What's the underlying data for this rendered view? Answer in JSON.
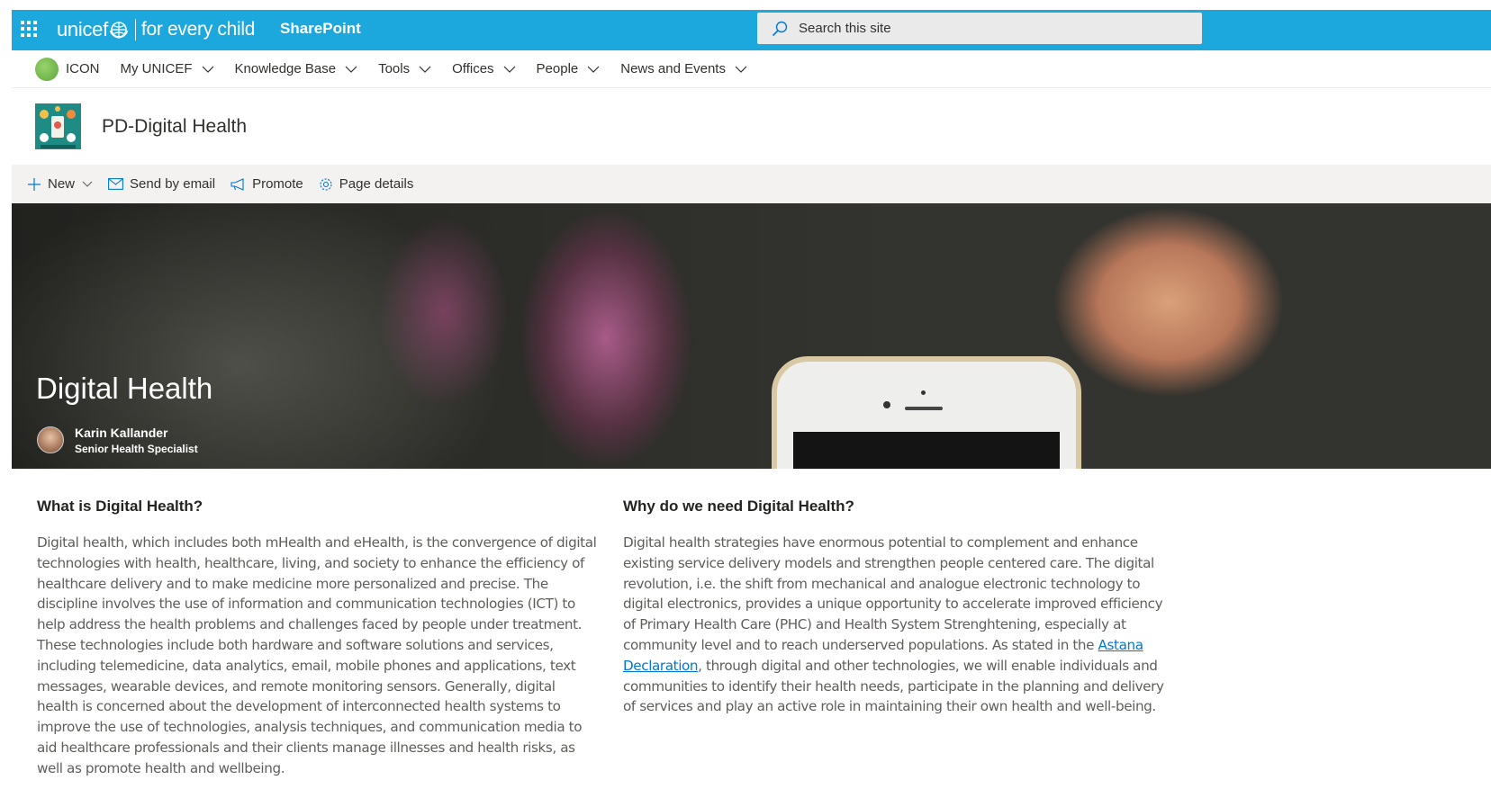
{
  "suitebar": {
    "brand_name": "unicef",
    "brand_tagline": "for every child",
    "app_name": "SharePoint",
    "search_placeholder": "Search this site",
    "background": "#1ca8dd"
  },
  "hubnav": {
    "hub_title": "ICON",
    "items": [
      {
        "label": "My UNICEF"
      },
      {
        "label": "Knowledge Base"
      },
      {
        "label": "Tools"
      },
      {
        "label": "Offices"
      },
      {
        "label": "People"
      },
      {
        "label": "News and Events"
      }
    ]
  },
  "site": {
    "title": "PD-Digital Health"
  },
  "commandbar": {
    "new_label": "New",
    "send_label": "Send by email",
    "promote_label": "Promote",
    "details_label": "Page details"
  },
  "banner": {
    "title": "Digital Health",
    "author_name": "Karin Kallander",
    "author_role": "Senior Health Specialist"
  },
  "content": {
    "left": {
      "heading": "What is Digital Health?",
      "body": "Digital health, which includes both mHealth and eHealth, is the convergence of digital technologies with health, healthcare, living, and society to enhance the efficiency of healthcare delivery and to make medicine more personalized and precise. The discipline involves the use of information and communication technologies (ICT) to help address the health problems and challenges faced by people under treatment. These technologies include both hardware and software solutions and services, including telemedicine, data analytics, email, mobile phones and applications, text messages, wearable devices, and remote monitoring sensors. Generally, digital health is concerned about the development of interconnected health systems to improve the use of technologies, analysis techniques, and communication media to aid healthcare professionals and their clients manage illnesses and health risks, as well as promote health and wellbeing."
    },
    "right": {
      "heading": "Why do we need Digital Health?",
      "body_before_link": "Digital health strategies have enormous potential to complement and enhance existing service delivery models and strengthen people centered care. The digital revolution, i.e. the shift from mechanical and analogue electronic technology to digital electronics, provides a unique opportunity to accelerate improved efficiency of Primary Health Care (PHC) and Health System Strenghtening, especially at community level and to reach underserved populations. As stated in the ",
      "link_text": "Astana Declaration",
      "body_after_link": ", through digital and other technologies, we will enable individuals and communities to identify their health needs, participate in the planning and delivery of services and play an active role in maintaining their own health and well-being."
    }
  }
}
